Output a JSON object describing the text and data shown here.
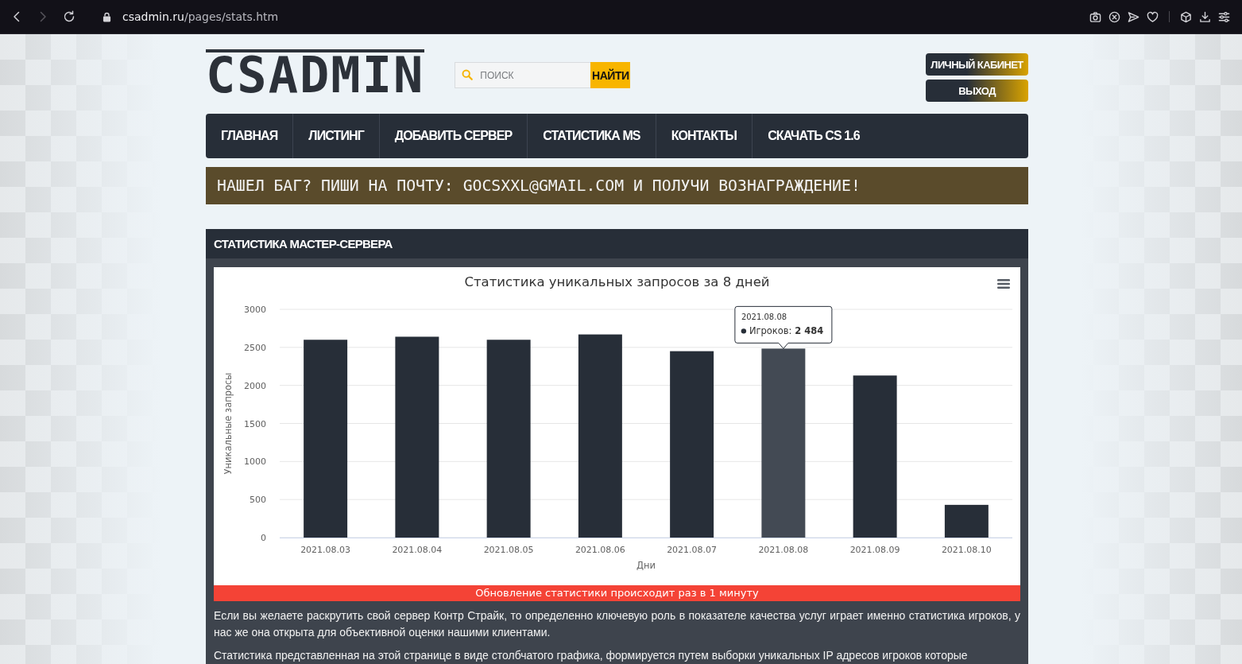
{
  "browser": {
    "nav_buttons": [
      {
        "kind": "back",
        "disabled": false
      },
      {
        "kind": "forward",
        "disabled": true
      },
      {
        "kind": "reload",
        "disabled": false
      }
    ],
    "url": {
      "domain": "csadmin.ru",
      "path": "/pages/stats.htm"
    },
    "tool_groups": [
      [
        {
          "kind": "camera"
        },
        {
          "kind": "block"
        },
        {
          "kind": "send"
        },
        {
          "kind": "heart"
        }
      ],
      [
        {
          "kind": "cube"
        },
        {
          "kind": "download"
        },
        {
          "kind": "sliders"
        }
      ]
    ]
  },
  "header": {
    "logo": "CSADMIN",
    "search": {
      "placeholder": "ПОИСК",
      "button": "НАЙТИ"
    },
    "account_buttons": [
      "ЛИЧНЫЙ КАБИНЕТ",
      "ВЫХОД"
    ]
  },
  "nav": [
    "ГЛАВНАЯ",
    "ЛИСТИНГ",
    "ДОБАВИТЬ СЕРВЕР",
    "СТАТИСТИКА MS",
    "КОНТАКТЫ",
    "СКАЧАТЬ CS 1.6"
  ],
  "banner": "НАШЕЛ БАГ? ПИШИ НА ПОЧТУ: GOCSXXL@GMAIL.COM И ПОЛУЧИ ВОЗНАГРАЖДЕНИЕ!",
  "stats_panel": {
    "title": "СТАТИСТИКА МАСТЕР-СЕРВЕРА",
    "chart": {
      "chart_data": {
        "type": "bar",
        "title": "Статистика уникальных запросов за 8 дней",
        "xlabel": "Дни",
        "ylabel": "Уникальные запросы",
        "categories": [
          "2021.08.03",
          "2021.08.04",
          "2021.08.05",
          "2021.08.06",
          "2021.08.07",
          "2021.08.08",
          "2021.08.09",
          "2021.08.10"
        ],
        "values": [
          2600,
          2640,
          2600,
          2670,
          2450,
          2484,
          2130,
          430
        ],
        "ylim": [
          0,
          3000
        ],
        "yticks": [
          0,
          500,
          1000,
          1500,
          2000,
          2500,
          3000
        ],
        "grid": true
      },
      "bars": [
        {
          "hovered": false
        },
        {
          "hovered": false
        },
        {
          "hovered": false
        },
        {
          "hovered": false
        },
        {
          "hovered": false
        },
        {
          "hovered": true
        },
        {
          "hovered": false
        },
        {
          "hovered": false
        }
      ],
      "tooltip": {
        "title": "2021.08.08",
        "label": "Игроков:",
        "value": "2 484"
      }
    },
    "notice": "Обновление статистики происходит раз в 1 минуту",
    "paragraphs": [
      "Если вы желаете раскрутить свой сервер Контр Страйк, то определенно ключевую роль в показателе качества услуг играет именно статистика игроков, у нас же она открыта для объективной оценки нашими клиентами.",
      "Статистика представленная на этой странице в виде столбчатого графика, формируется путем выборки уникальных IP адресов игроков которые"
    ]
  }
}
